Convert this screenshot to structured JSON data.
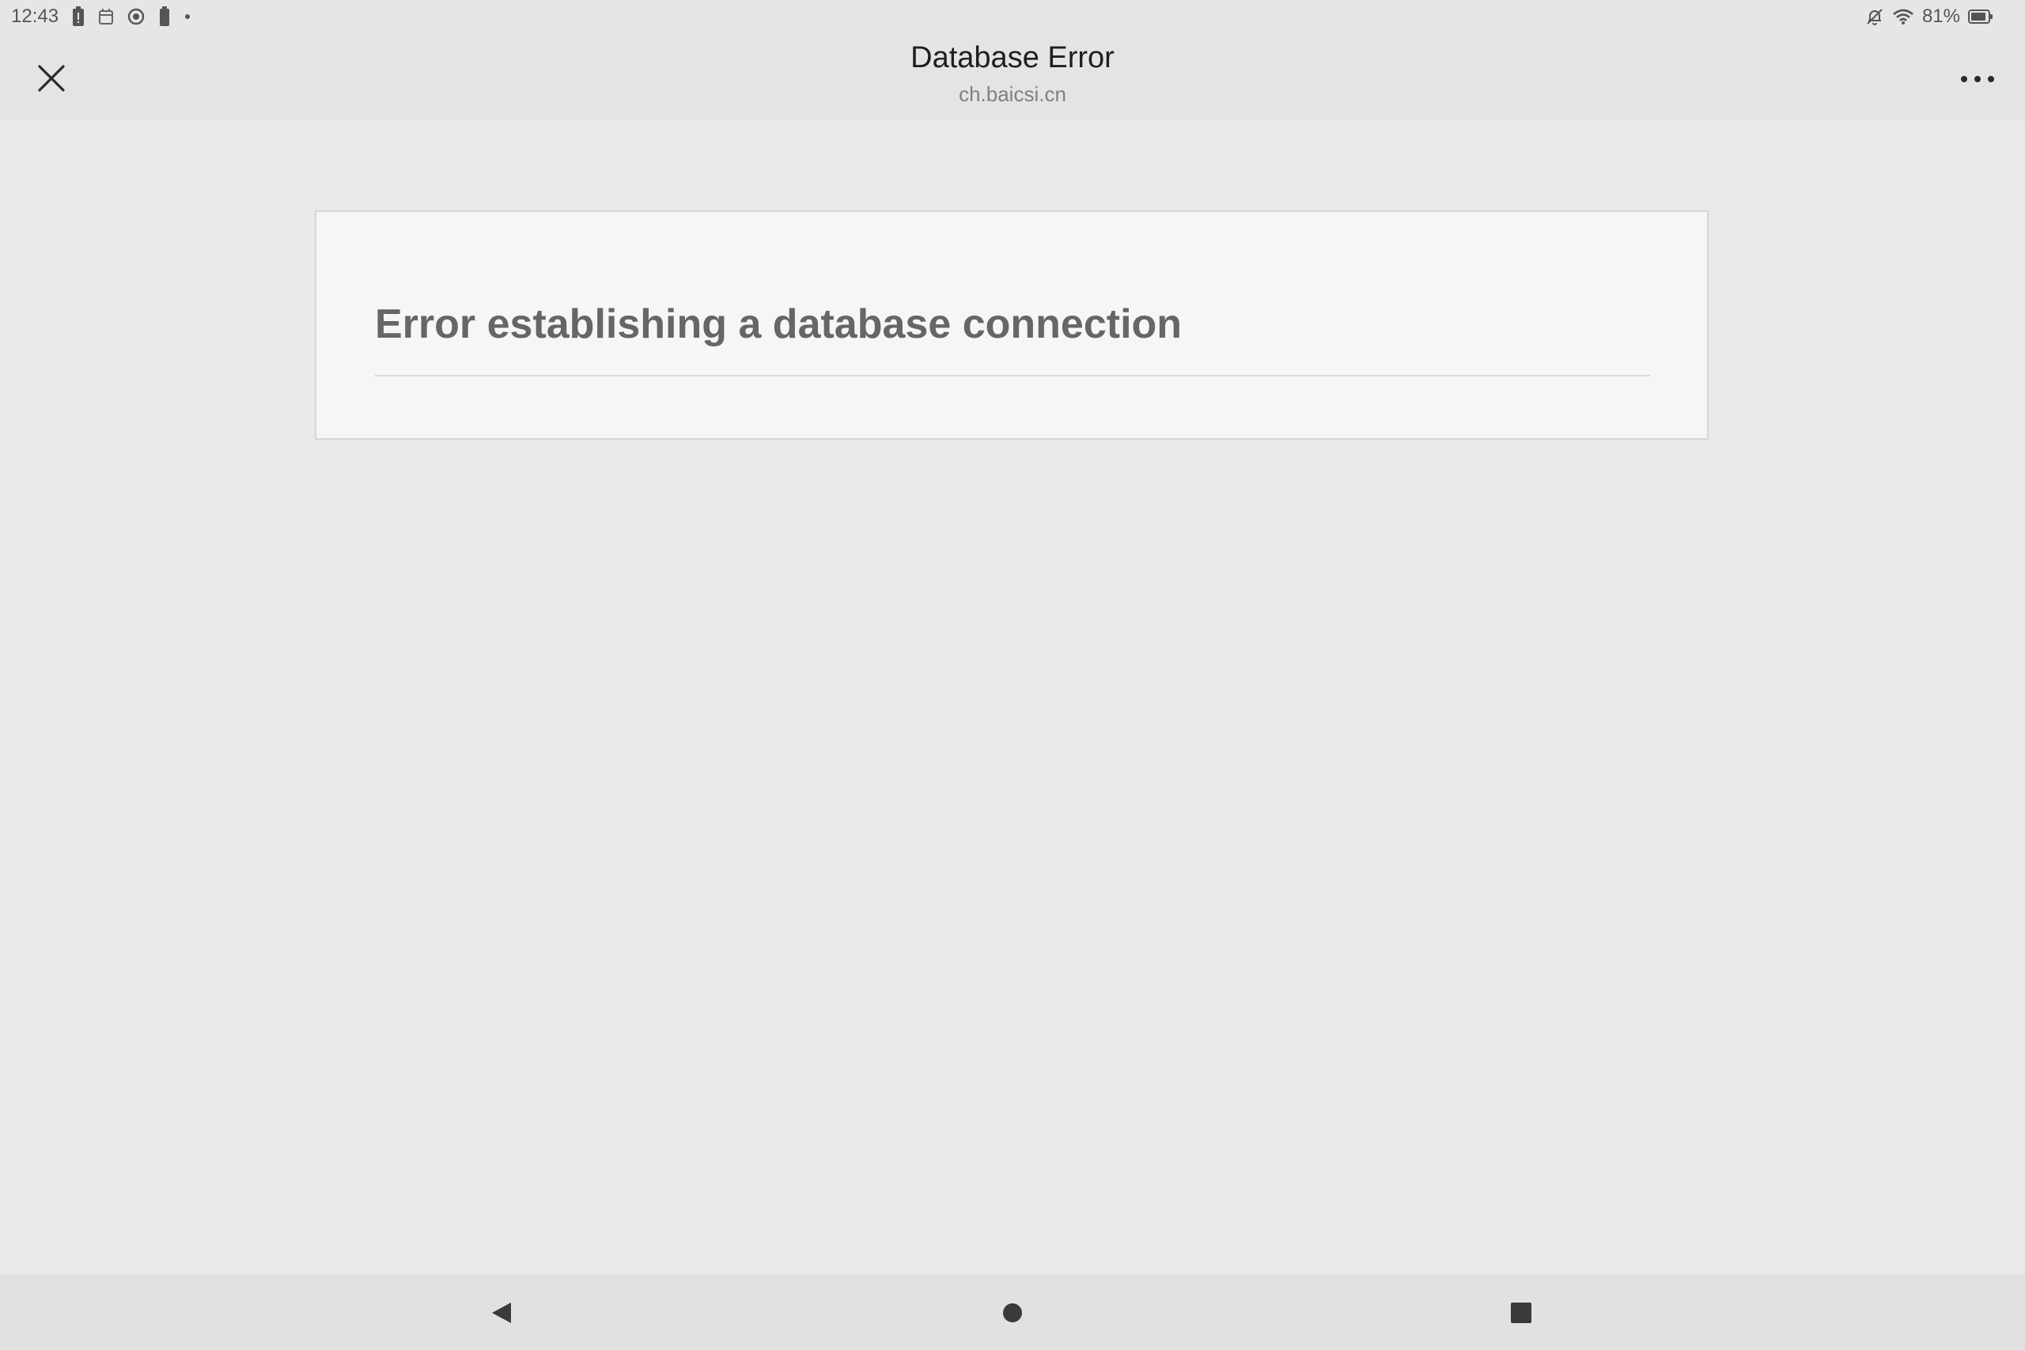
{
  "status_bar": {
    "time": "12:43",
    "battery_percent": "81%",
    "left_icons": [
      "battery-alert-icon",
      "calendar-icon",
      "record-icon",
      "battery-icon",
      "dot-icon"
    ],
    "right_icons": [
      "bell-off-icon",
      "wifi-icon",
      "battery-icon"
    ]
  },
  "title_bar": {
    "title": "Database Error",
    "domain": "ch.baicsi.cn",
    "close_icon": "close-icon",
    "more_icon": "more-horizontal-icon"
  },
  "content": {
    "error_heading": "Error establishing a database connection"
  },
  "nav_bar": {
    "buttons": [
      "back-triangle-icon",
      "home-circle-icon",
      "recents-square-icon"
    ]
  },
  "colors": {
    "background": "#e9e9e9",
    "card_background": "#f6f6f6",
    "card_border": "#d6d6d6",
    "heading_text": "#666666",
    "title_text": "#1f1f1f"
  }
}
